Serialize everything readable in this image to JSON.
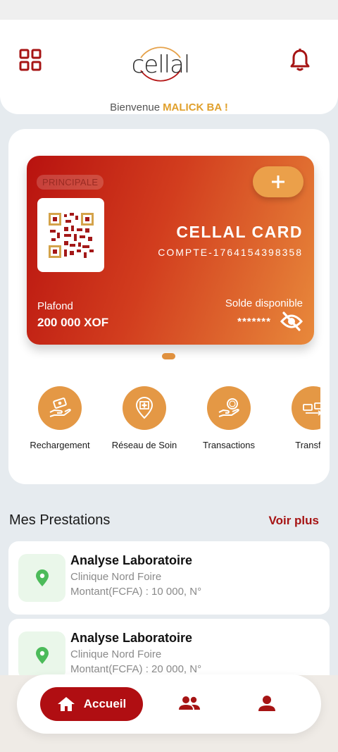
{
  "header": {
    "logo_text": "cellal",
    "welcome": "Bienvenue",
    "user_name": "MALICK BA !"
  },
  "card": {
    "badge": "PRINCIPALE",
    "add_symbol": "+",
    "title": "CELLAL CARD",
    "account": "COMPTE-1764154398358",
    "plafond_label": "Plafond",
    "plafond_value": "200 000 XOF",
    "solde_label": "Solde disponible",
    "solde_mask": "*******"
  },
  "actions": [
    {
      "label": "Rechargement",
      "icon": "hand-money-icon"
    },
    {
      "label": "Réseau de Soin",
      "icon": "location-hospital-icon"
    },
    {
      "label": "Transactions",
      "icon": "coin-hand-icon"
    },
    {
      "label": "Transfert",
      "icon": "transfer-icon"
    }
  ],
  "prestations": {
    "title": "Mes Prestations",
    "voir_plus": "Voir plus",
    "items": [
      {
        "title": "Analyse Laboratoire",
        "provider": "Clinique Nord Foire",
        "amount": "Montant(FCFA) : 10 000, N°"
      },
      {
        "title": "Analyse Laboratoire",
        "provider": "Clinique Nord Foire",
        "amount": "Montant(FCFA) : 20 000, N°"
      }
    ]
  },
  "nav": {
    "home_label": "Accueil"
  },
  "colors": {
    "primary": "#b00e12",
    "accent": "#e49845",
    "gold": "#e0a02c",
    "pin_green": "#4cbb5a"
  }
}
